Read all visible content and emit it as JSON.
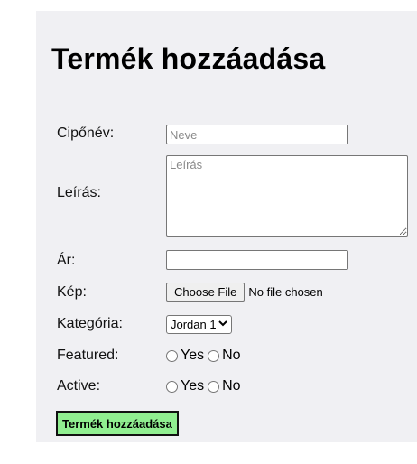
{
  "form": {
    "title": "Termék hozzáadása",
    "name_label": "Cipőnév:",
    "name_placeholder": "Neve",
    "description_label": "Leírás:",
    "description_placeholder": "Leírás",
    "price_label": "Ár:",
    "image_label": "Kép:",
    "file_button": "Choose File",
    "file_status": "No file chosen",
    "category_label": "Kategória:",
    "category_selected": "Jordan 1",
    "featured_label": "Featured:",
    "active_label": "Active:",
    "yes": "Yes",
    "no": "No",
    "submit": "Termék hozzáadása",
    "submit_color": "#90ee90"
  }
}
